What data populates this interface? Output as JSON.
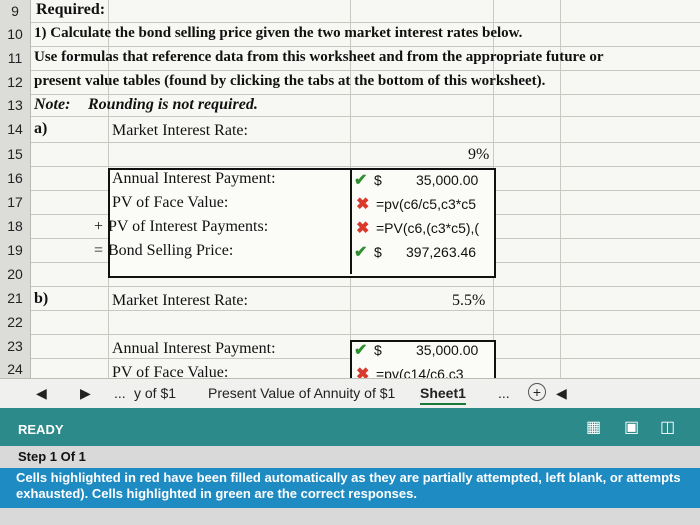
{
  "rows": [
    "9",
    "10",
    "11",
    "12",
    "13",
    "14",
    "15",
    "16",
    "17",
    "18",
    "19",
    "20",
    "21",
    "22",
    "23",
    "24"
  ],
  "instructions": {
    "required": "Required:",
    "line1": "1) Calculate the bond selling price given the two market interest rates below.",
    "line2": "Use formulas that reference data from this worksheet and from the appropriate future or",
    "line3": "present value tables (found by clicking the tabs at the bottom of this worksheet).",
    "note_label": "Note:",
    "note_text": "Rounding is not required."
  },
  "part_a": {
    "label": "a)",
    "rate_label": "Market Interest Rate:",
    "rate_value": "9%",
    "interest_label": "Annual Interest Payment:",
    "interest_dollar": "$",
    "interest_value": "35,000.00",
    "pv_face_label": "PV of Face Value:",
    "pv_face_value": "=pv(c6/c5,c3*c5",
    "plus_sign": "+",
    "pv_interest_label": "PV of Interest Payments:",
    "pv_interest_value": "=PV(c6,(c3*c5),(",
    "equals_sign": "=",
    "price_label": "Bond Selling Price:",
    "price_dollar": "$",
    "price_value": "397,263.46"
  },
  "part_b": {
    "label": "b)",
    "rate_label": "Market Interest Rate:",
    "rate_value": "5.5%",
    "interest_label": "Annual Interest Payment:",
    "interest_dollar": "$",
    "interest_value": "35,000.00",
    "pv_face_label_partial": "PV of Face Value:",
    "pv_face_value_partial": "=pv(c14/c6,c3"
  },
  "tabs": {
    "ellipsis_left": "...",
    "tab1": "y of $1",
    "tab2": "Present Value of Annuity of $1",
    "tab3": "Sheet1",
    "ellipsis_right": "...",
    "add": "+"
  },
  "status": {
    "ready": "READY"
  },
  "step": {
    "title": "Step 1 Of 1",
    "message": "Cells highlighted in red have been filled automatically as they are partially attempted, left blank, or attempts exhausted). Cells highlighted in green are the correct responses."
  },
  "colors": {
    "status_bar": "#2c8a8a",
    "banner": "#1f8bc3",
    "check": "#2f8f2f",
    "cross": "#d93a2b"
  }
}
